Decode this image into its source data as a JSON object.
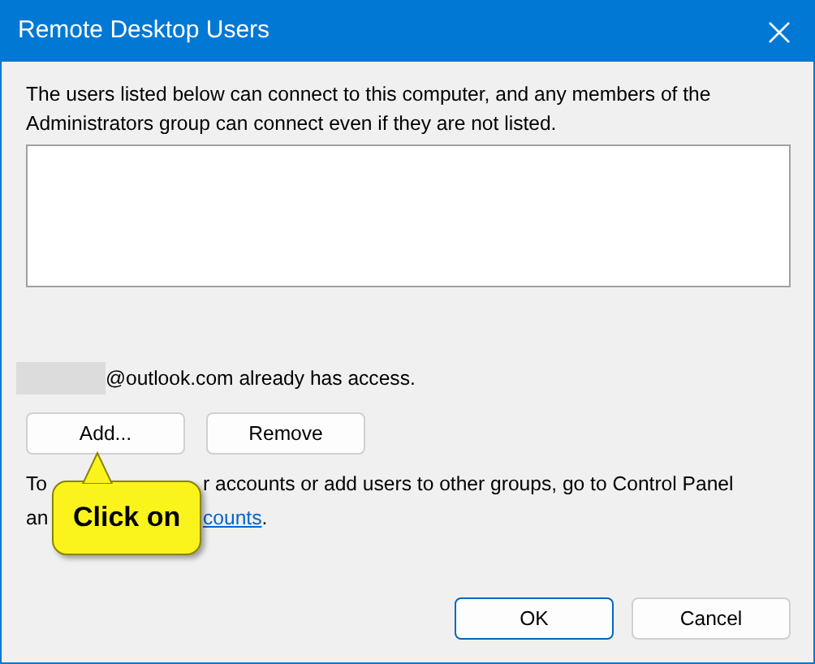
{
  "window": {
    "title": "Remote Desktop Users"
  },
  "description": "The users listed below can connect to this computer, and any members of the Administrators group can connect even if they are not listed.",
  "access_note": "@outlook.com already has access.",
  "buttons": [
    {
      "label": "Add..."
    },
    {
      "label": "Remove"
    }
  ],
  "footer_text": {
    "line_1_start": "To",
    "line_1_end": "r accounts or add users to other groups, go to Control Panel",
    "line_2_start": "an",
    "link": "counts",
    "line_2_end": "."
  },
  "callout": {
    "text": "Click on"
  },
  "dialog_buttons": [
    {
      "label": "OK",
      "kind": "default"
    },
    {
      "label": "Cancel",
      "kind": "normal"
    }
  ]
}
